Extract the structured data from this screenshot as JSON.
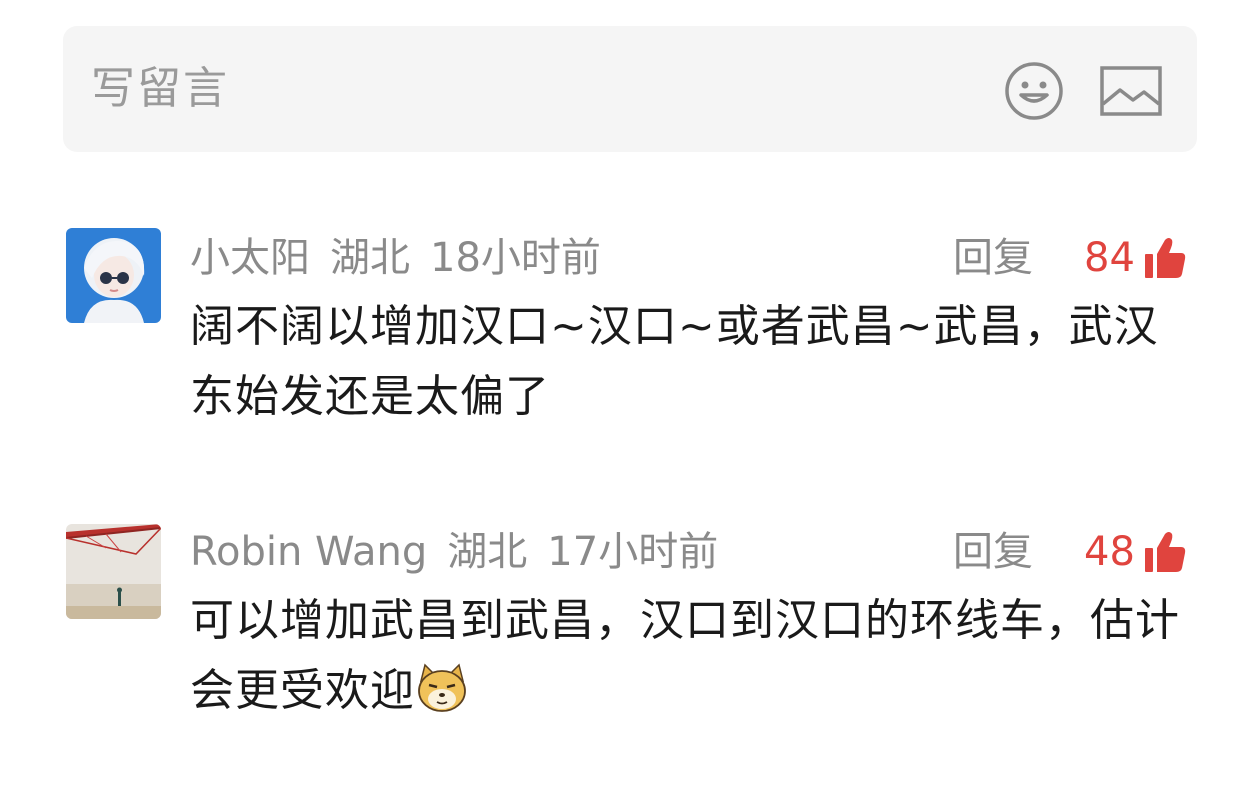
{
  "input": {
    "placeholder": "写留言",
    "emoji_icon": "smiley-face-icon",
    "image_icon": "image-picture-icon"
  },
  "comments": [
    {
      "avatar_icon": "avatar-girl-sunglasses",
      "username": "小太阳",
      "location": "湖北",
      "time": "18小时前",
      "reply_label": "回复",
      "likes": "84",
      "text": "阔不阔以增加汉口~汉口~或者武昌~武昌，武汉东始发还是太偏了"
    },
    {
      "avatar_icon": "avatar-bridge-photo",
      "username": "Robin Wang",
      "location": "湖北",
      "time": "17小时前",
      "reply_label": "回复",
      "likes": "48",
      "text": "可以增加武昌到武昌，汉口到汉口的环线车，估计会更受欢迎",
      "trailing_emoji": "doge-emoji"
    }
  ],
  "colors": {
    "like_red": "#e0443e",
    "meta_gray": "#8a8a8a",
    "input_bg": "#f5f5f5"
  }
}
